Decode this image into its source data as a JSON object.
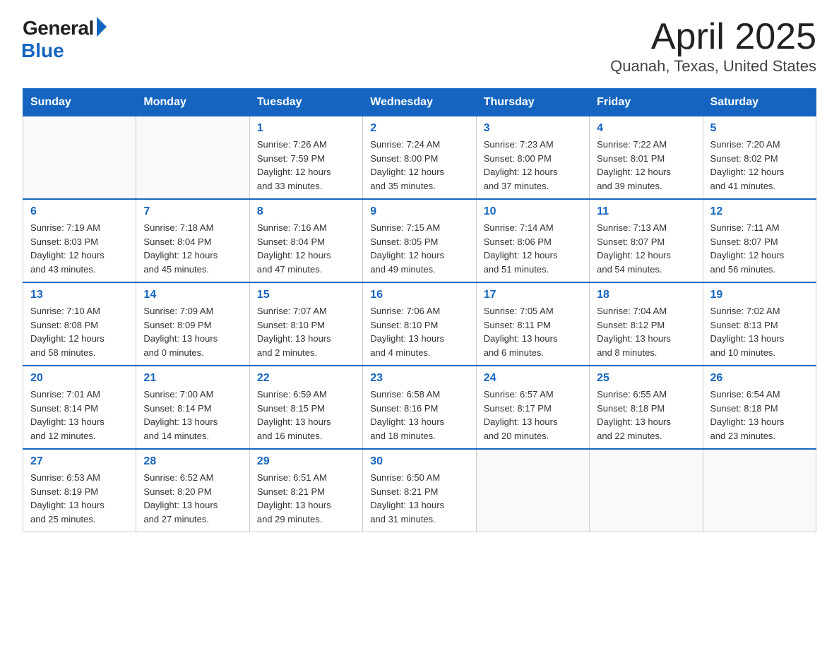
{
  "logo": {
    "general": "General",
    "blue": "Blue"
  },
  "title": "April 2025",
  "subtitle": "Quanah, Texas, United States",
  "days_of_week": [
    "Sunday",
    "Monday",
    "Tuesday",
    "Wednesday",
    "Thursday",
    "Friday",
    "Saturday"
  ],
  "weeks": [
    [
      {
        "day": "",
        "info": ""
      },
      {
        "day": "",
        "info": ""
      },
      {
        "day": "1",
        "info": "Sunrise: 7:26 AM\nSunset: 7:59 PM\nDaylight: 12 hours\nand 33 minutes."
      },
      {
        "day": "2",
        "info": "Sunrise: 7:24 AM\nSunset: 8:00 PM\nDaylight: 12 hours\nand 35 minutes."
      },
      {
        "day": "3",
        "info": "Sunrise: 7:23 AM\nSunset: 8:00 PM\nDaylight: 12 hours\nand 37 minutes."
      },
      {
        "day": "4",
        "info": "Sunrise: 7:22 AM\nSunset: 8:01 PM\nDaylight: 12 hours\nand 39 minutes."
      },
      {
        "day": "5",
        "info": "Sunrise: 7:20 AM\nSunset: 8:02 PM\nDaylight: 12 hours\nand 41 minutes."
      }
    ],
    [
      {
        "day": "6",
        "info": "Sunrise: 7:19 AM\nSunset: 8:03 PM\nDaylight: 12 hours\nand 43 minutes."
      },
      {
        "day": "7",
        "info": "Sunrise: 7:18 AM\nSunset: 8:04 PM\nDaylight: 12 hours\nand 45 minutes."
      },
      {
        "day": "8",
        "info": "Sunrise: 7:16 AM\nSunset: 8:04 PM\nDaylight: 12 hours\nand 47 minutes."
      },
      {
        "day": "9",
        "info": "Sunrise: 7:15 AM\nSunset: 8:05 PM\nDaylight: 12 hours\nand 49 minutes."
      },
      {
        "day": "10",
        "info": "Sunrise: 7:14 AM\nSunset: 8:06 PM\nDaylight: 12 hours\nand 51 minutes."
      },
      {
        "day": "11",
        "info": "Sunrise: 7:13 AM\nSunset: 8:07 PM\nDaylight: 12 hours\nand 54 minutes."
      },
      {
        "day": "12",
        "info": "Sunrise: 7:11 AM\nSunset: 8:07 PM\nDaylight: 12 hours\nand 56 minutes."
      }
    ],
    [
      {
        "day": "13",
        "info": "Sunrise: 7:10 AM\nSunset: 8:08 PM\nDaylight: 12 hours\nand 58 minutes."
      },
      {
        "day": "14",
        "info": "Sunrise: 7:09 AM\nSunset: 8:09 PM\nDaylight: 13 hours\nand 0 minutes."
      },
      {
        "day": "15",
        "info": "Sunrise: 7:07 AM\nSunset: 8:10 PM\nDaylight: 13 hours\nand 2 minutes."
      },
      {
        "day": "16",
        "info": "Sunrise: 7:06 AM\nSunset: 8:10 PM\nDaylight: 13 hours\nand 4 minutes."
      },
      {
        "day": "17",
        "info": "Sunrise: 7:05 AM\nSunset: 8:11 PM\nDaylight: 13 hours\nand 6 minutes."
      },
      {
        "day": "18",
        "info": "Sunrise: 7:04 AM\nSunset: 8:12 PM\nDaylight: 13 hours\nand 8 minutes."
      },
      {
        "day": "19",
        "info": "Sunrise: 7:02 AM\nSunset: 8:13 PM\nDaylight: 13 hours\nand 10 minutes."
      }
    ],
    [
      {
        "day": "20",
        "info": "Sunrise: 7:01 AM\nSunset: 8:14 PM\nDaylight: 13 hours\nand 12 minutes."
      },
      {
        "day": "21",
        "info": "Sunrise: 7:00 AM\nSunset: 8:14 PM\nDaylight: 13 hours\nand 14 minutes."
      },
      {
        "day": "22",
        "info": "Sunrise: 6:59 AM\nSunset: 8:15 PM\nDaylight: 13 hours\nand 16 minutes."
      },
      {
        "day": "23",
        "info": "Sunrise: 6:58 AM\nSunset: 8:16 PM\nDaylight: 13 hours\nand 18 minutes."
      },
      {
        "day": "24",
        "info": "Sunrise: 6:57 AM\nSunset: 8:17 PM\nDaylight: 13 hours\nand 20 minutes."
      },
      {
        "day": "25",
        "info": "Sunrise: 6:55 AM\nSunset: 8:18 PM\nDaylight: 13 hours\nand 22 minutes."
      },
      {
        "day": "26",
        "info": "Sunrise: 6:54 AM\nSunset: 8:18 PM\nDaylight: 13 hours\nand 23 minutes."
      }
    ],
    [
      {
        "day": "27",
        "info": "Sunrise: 6:53 AM\nSunset: 8:19 PM\nDaylight: 13 hours\nand 25 minutes."
      },
      {
        "day": "28",
        "info": "Sunrise: 6:52 AM\nSunset: 8:20 PM\nDaylight: 13 hours\nand 27 minutes."
      },
      {
        "day": "29",
        "info": "Sunrise: 6:51 AM\nSunset: 8:21 PM\nDaylight: 13 hours\nand 29 minutes."
      },
      {
        "day": "30",
        "info": "Sunrise: 6:50 AM\nSunset: 8:21 PM\nDaylight: 13 hours\nand 31 minutes."
      },
      {
        "day": "",
        "info": ""
      },
      {
        "day": "",
        "info": ""
      },
      {
        "day": "",
        "info": ""
      }
    ]
  ]
}
